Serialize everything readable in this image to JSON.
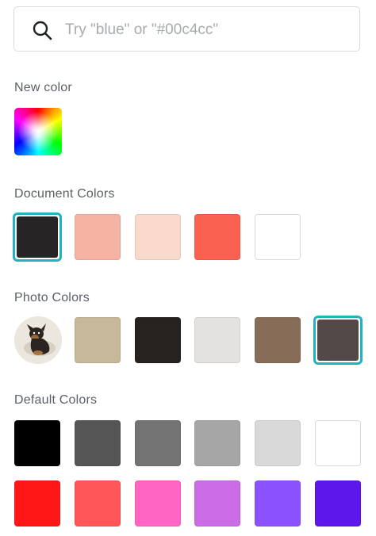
{
  "search": {
    "placeholder": "Try \"blue\" or \"#00c4cc\""
  },
  "new_color": {
    "label": "New color"
  },
  "document_colors": {
    "label": "Document Colors",
    "swatches": [
      "#262424",
      "#f6b3a3",
      "#f8d9cb",
      "#fb6150",
      "#ffffff"
    ],
    "selected_index": 0
  },
  "photo_colors": {
    "label": "Photo Colors",
    "swatches": [
      "#c6b898",
      "#252220",
      "#e4e1e1",
      "#876d58",
      "#524948"
    ],
    "selected_index": 4
  },
  "default_colors": {
    "label": "Default Colors",
    "row1": [
      "#000000",
      "#555555",
      "#737373",
      "#a6a6a6",
      "#d9d9d9",
      "#ffffff"
    ],
    "row2": [
      "#ff1616",
      "#ff5757",
      "#ff66c4",
      "#cb6ce6",
      "#8c52ff",
      "#5e17eb"
    ]
  },
  "accent_color": "#21b1bf"
}
